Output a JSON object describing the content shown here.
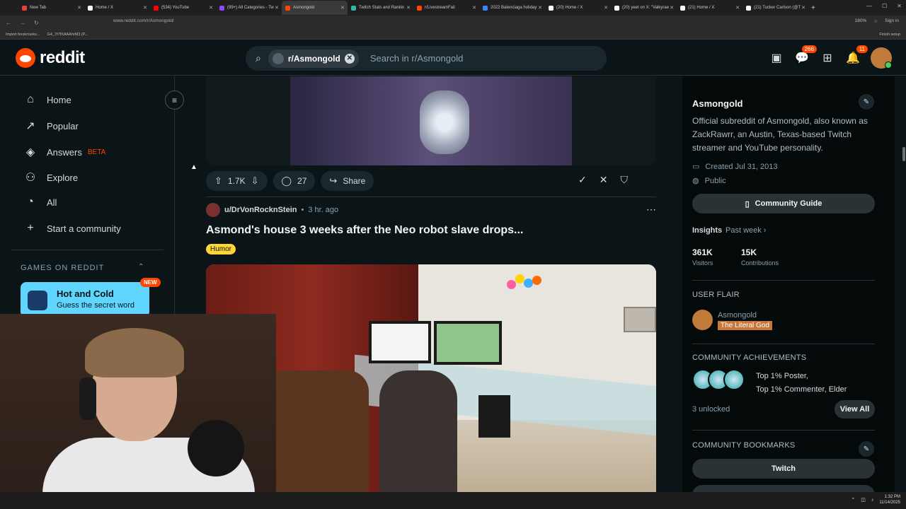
{
  "browser": {
    "tabs": [
      {
        "title": "New Tab",
        "color": "#e94235"
      },
      {
        "title": "Home / X",
        "color": "#ffffff"
      },
      {
        "title": "(534) YouTube",
        "color": "#ff0000"
      },
      {
        "title": "(99+) All Categories - Tw",
        "color": "#9146ff"
      },
      {
        "title": "Asmongold",
        "color": "#ff4500",
        "active": true
      },
      {
        "title": "Twitch Stats and Rankin",
        "color": "#2fb8a0"
      },
      {
        "title": "r/LivestreamFail",
        "color": "#ff4500"
      },
      {
        "title": "2022 Balenciaga holiday",
        "color": "#3a86ff"
      },
      {
        "title": "(20) Home / X",
        "color": "#ffffff"
      },
      {
        "title": "(20) yeet on X: \"Valkyrae",
        "color": "#ffffff"
      },
      {
        "title": "(21) Home / X",
        "color": "#ffffff"
      },
      {
        "title": "(21) Tucker Carlson (@T",
        "color": "#ffffff"
      }
    ],
    "url": "www.reddit.com/r/Asmongold/",
    "zoom": "180%",
    "sign_in": "Sign in",
    "bookmarks": [
      "Import bookmarks...",
      "G4_7t7fXAAAhrM3 (P..."
    ],
    "finish_setup": "Finish setup"
  },
  "header": {
    "logo_text": "reddit",
    "search": {
      "chip_label": "r/Asmongold",
      "placeholder": "Search in r/Asmongold"
    },
    "chat_badge": "266",
    "notif_badge": "11"
  },
  "leftnav": {
    "items": [
      {
        "label": "Home",
        "icon": "home-icon"
      },
      {
        "label": "Popular",
        "icon": "popular-icon"
      },
      {
        "label": "Answers",
        "icon": "answers-icon",
        "badge": "BETA"
      },
      {
        "label": "Explore",
        "icon": "explore-icon"
      },
      {
        "label": "All",
        "icon": "all-icon"
      },
      {
        "label": "Start a community",
        "icon": "plus-icon"
      }
    ],
    "games_header": "GAMES ON REDDIT",
    "game": {
      "title": "Hot and Cold",
      "subtitle": "Guess the secret word",
      "badge": "NEW"
    }
  },
  "feed": {
    "prev_post": {
      "votes": "1.7K",
      "comments": "27",
      "share": "Share"
    },
    "post": {
      "author": "u/DrVonRocknStein",
      "time": "3 hr. ago",
      "title": "Asmond's house 3 weeks after the Neo robot slave drops...",
      "flair": "Humor"
    }
  },
  "sidebar": {
    "title": "Asmongold",
    "description": "Official subreddit of Asmongold, also known as ZackRawrr, an Austin, Texas-based Twitch streamer and YouTube personality.",
    "created": "Created Jul 31, 2013",
    "visibility": "Public",
    "community_guide": "Community Guide",
    "insights_label": "Insights",
    "insights_period": "Past week",
    "stats": [
      {
        "value": "361K",
        "label": "Visitors"
      },
      {
        "value": "15K",
        "label": "Contributions"
      }
    ],
    "user_flair_header": "USER FLAIR",
    "user_flair_name": "Asmongold",
    "user_flair_tag": "The Literal God",
    "achievements_header": "COMMUNITY ACHIEVEMENTS",
    "achievements_line1": "Top 1% Poster,",
    "achievements_line2": "Top 1% Commenter, Elder",
    "unlocked": "3 unlocked",
    "view_all": "View All",
    "bookmarks_header": "COMMUNITY BOOKMARKS",
    "bookmark_twitch": "Twitch"
  },
  "taskbar": {
    "time": "1:32 PM",
    "date": "11/14/2025"
  },
  "colors": {
    "accent": "#ff4500",
    "flair": "#ffd635",
    "background": "#0b1416"
  }
}
